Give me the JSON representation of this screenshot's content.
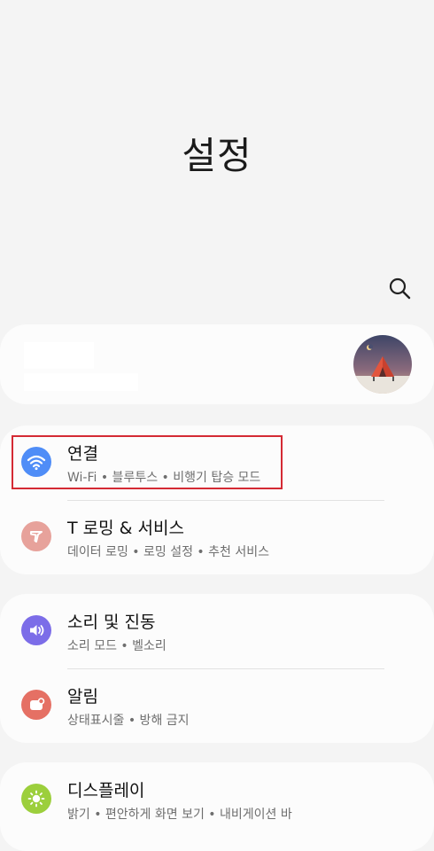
{
  "header": {
    "title": "설정"
  },
  "search": {
    "icon": "search-icon"
  },
  "colors": {
    "background": "#f4f4f4",
    "card": "#fcfcfc",
    "highlight": "#d42a34",
    "connection_icon": "#4f8df7",
    "troaming_icon": "#e7a29b",
    "sound_icon": "#7c6de8",
    "notification_icon": "#e57064",
    "display_icon": "#9ccf3c"
  },
  "settings": {
    "connections": {
      "title": "연결",
      "subtitle": "Wi-Fi • 블루투스 • 비행기 탑승 모드",
      "icon": "wifi-icon"
    },
    "troaming": {
      "title": "T 로밍 & 서비스",
      "subtitle": "데이터 로밍 • 로밍 설정 • 추천 서비스",
      "icon": "troaming-icon"
    },
    "sound": {
      "title": "소리 및 진동",
      "subtitle": "소리 모드 • 벨소리",
      "icon": "volume-icon"
    },
    "notifications": {
      "title": "알림",
      "subtitle": "상태표시줄 • 방해 금지",
      "icon": "notification-icon"
    },
    "display": {
      "title": "디스플레이",
      "subtitle": "밝기 • 편안하게 화면 보기 • 내비게이션 바",
      "icon": "sun-icon"
    }
  }
}
